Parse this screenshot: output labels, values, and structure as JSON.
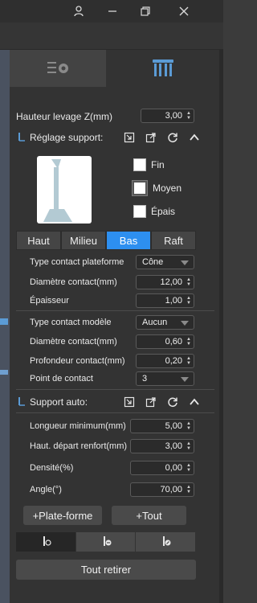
{
  "window": {
    "user_icon": "person-icon",
    "restore_icon": "restore-icon",
    "close_icon": "close-icon"
  },
  "tabs": [
    {
      "icon": "settings-gear-icon"
    },
    {
      "icon": "support-table-icon"
    }
  ],
  "lift_height": {
    "label": "Hauteur levage Z(mm)",
    "value": "3,00"
  },
  "support_settings": {
    "title": "Réglage support:"
  },
  "density_options": {
    "fine": "Fin",
    "medium": "Moyen",
    "thick": "Épais",
    "selected": "medium"
  },
  "segments": [
    {
      "label": "Haut",
      "active": false
    },
    {
      "label": "Milieu",
      "active": false
    },
    {
      "label": "Bas",
      "active": true
    },
    {
      "label": "Raft",
      "active": false
    }
  ],
  "fields1": {
    "contact_type_platform": {
      "label": "Type contact plateforme",
      "value": "Cône"
    },
    "contact_diameter": {
      "label": "Diamètre contact(mm)",
      "value": "12,00"
    },
    "thickness": {
      "label": "Épaisseur",
      "value": "1,00"
    }
  },
  "fields2": {
    "model_contact_type": {
      "label": "Type contact modèle",
      "value": "Aucun"
    },
    "contact_diameter": {
      "label": "Diamètre contact(mm)",
      "value": "0,60"
    },
    "contact_depth": {
      "label": "Profondeur contact(mm)",
      "value": "0,20"
    },
    "contact_point": {
      "label": "Point de contact",
      "value": "3"
    }
  },
  "auto_support": {
    "title": "Support auto:",
    "min_length": {
      "label": "Longueur minimum(mm)",
      "value": "5,00"
    },
    "reinforce_start": {
      "label": "Haut. départ renfort(mm)",
      "value": "3,00"
    },
    "density": {
      "label": "Densité(%)",
      "value": "0,00"
    },
    "angle": {
      "label": "Angle(°)",
      "value": "70,00"
    }
  },
  "buttons": {
    "add_platform": "+Plate-forme",
    "add_all": "+Tout",
    "remove_all": "Tout retirer"
  },
  "colors": {
    "accent": "#2d8ff0",
    "panel": "#333333"
  }
}
